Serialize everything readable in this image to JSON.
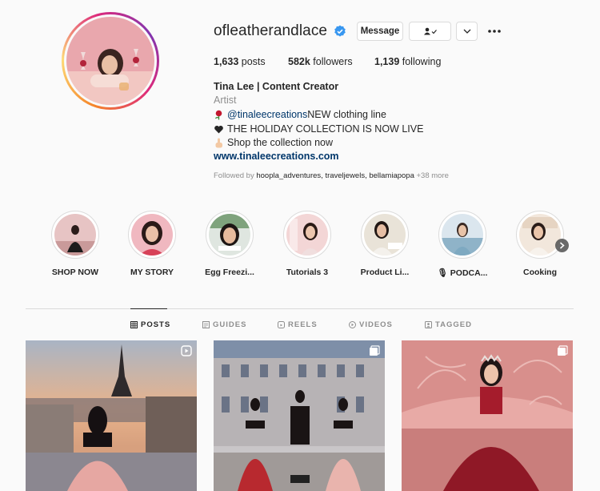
{
  "profile": {
    "username": "ofleatherandlace",
    "verified_icon": "verified-badge-icon",
    "buttons": {
      "message": "Message"
    },
    "stats": {
      "posts_count": "1,633",
      "posts_label": " posts",
      "followers_count": "582k",
      "followers_label": " followers",
      "following_count": "1,139",
      "following_label": " following"
    },
    "bio": {
      "name": "Tina Lee | Content Creator",
      "category": "Artist",
      "line1_mention": "@tinaleecreations",
      "line1_text": " NEW clothing line",
      "line2_text": "THE HOLIDAY COLLECTION IS NOW LIVE",
      "line3_text": "Shop the collection now",
      "link": "www.tinaleecreations.com"
    },
    "followed_by": {
      "prefix": "Followed by ",
      "names": "hoopla_adventures, traveljewels, bellamiapopa",
      "more": " +38 more"
    }
  },
  "highlights": [
    {
      "label": "SHOP NOW"
    },
    {
      "label": "MY STORY"
    },
    {
      "label": "Egg Freezi..."
    },
    {
      "label": "Tutorials 3"
    },
    {
      "label": "Product Li..."
    },
    {
      "label": "PODCA...",
      "prefix_icon": "microphone-icon"
    },
    {
      "label": "Cooking"
    }
  ],
  "tabs": [
    {
      "label": "POSTS",
      "icon": "grid-icon",
      "active": true
    },
    {
      "label": "GUIDES",
      "icon": "guide-icon",
      "active": false
    },
    {
      "label": "REELS",
      "icon": "reels-icon",
      "active": false
    },
    {
      "label": "VIDEOS",
      "icon": "video-icon",
      "active": false
    },
    {
      "label": "TAGGED",
      "icon": "tagged-icon",
      "active": false
    }
  ],
  "colors": {
    "link": "#00376b",
    "secondary_text": "#8e8e8e",
    "verified": "#3897f0",
    "border": "#dbdbdb"
  }
}
